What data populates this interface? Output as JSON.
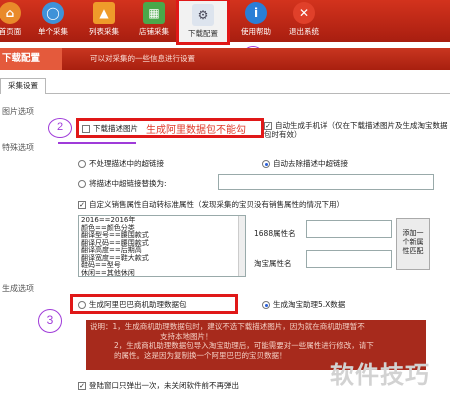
{
  "toolbar": {
    "items": [
      {
        "label": "首页面",
        "icon": "home-icon"
      },
      {
        "label": "单个采集",
        "icon": "search-icon"
      },
      {
        "label": "列表采集",
        "icon": "triangle-list-icon"
      },
      {
        "label": "店铺采集",
        "icon": "shop-icon"
      },
      {
        "label": "下载配置",
        "icon": "download-config-icon"
      },
      {
        "label": "使用帮助",
        "icon": "info-icon"
      },
      {
        "label": "退出系统",
        "icon": "exit-icon"
      }
    ]
  },
  "banner": {
    "title": "下载配置",
    "subtitle": "可以对采集的一些信息进行设置"
  },
  "annotations": {
    "one": "1",
    "two": "2",
    "three": "3"
  },
  "tab": {
    "label": "采集设置"
  },
  "image_options": {
    "section": "图片选项",
    "download_desc_images": "下载描述图片",
    "warning": "生成阿里数据包不能勾",
    "auto_phone_detail": "自动生成手机详（仅在下载描述图片及生成淘宝数据包时有效）"
  },
  "special_options": {
    "section": "特殊选项",
    "radio_keep_links": "不处理描述中的超链接",
    "radio_auto_remove": "自动去除描述中超链接",
    "radio_replace": "将描述中超链接替换为:",
    "attr_conversion": "自定义销售属性自动转标准属性（发现采集的宝贝没有销售属性的情况下用）",
    "attr_lines": [
      "2016==2016年",
      "颜色==颜色分类",
      "翻译型号==腰围款式",
      "翻译尺码==腰围款式",
      "翻译高度==后期高",
      "翻译宽度==鞋大款式",
      "鞋码==型号",
      "休闲==其他休闲"
    ],
    "attr_1688_label": "1688属性名",
    "attr_taobao_label": "淘宝属性名",
    "add_attr_button": "添加一个新属性匹配"
  },
  "generate_options": {
    "section": "生成选项",
    "radio_alibaba": "生成阿里巴巴商机助理数据包",
    "radio_taobao": "生成淘宝助理5.X数据",
    "notice_lines": [
      "说明：1，生成商机助理数据包时，建议不选下载描述图片，因为就在商机助理暂不",
      "支持本地图片！",
      "2，生成商机助理数据包导入淘宝助理后，可能需要对一些属性进行修改，请下",
      "的属性。这是因为复制换一个阿里巴巴的宝贝数据！"
    ]
  },
  "footer": {
    "popup_once": "登陆窗口只弹出一次，未关闭软件前不再弹出"
  },
  "watermark": "软件技巧"
}
